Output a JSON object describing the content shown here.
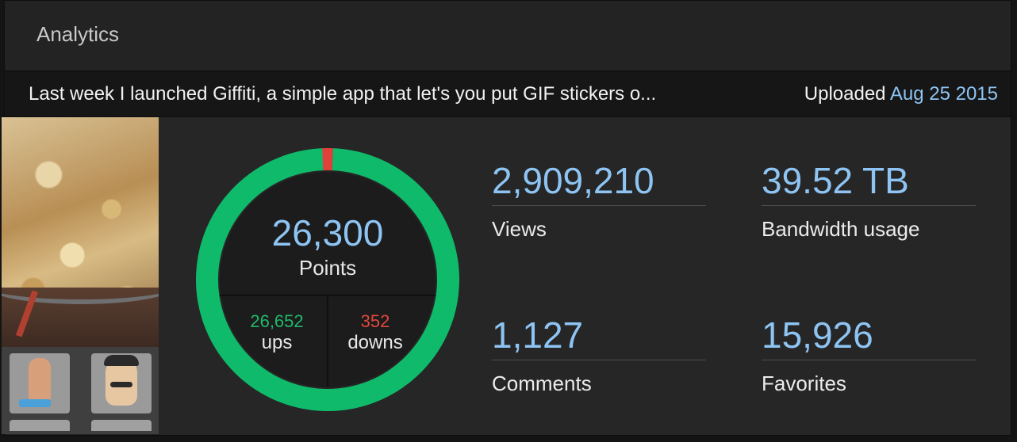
{
  "panel": {
    "title": "Analytics"
  },
  "post": {
    "title": "Last week I launched Giffiti, a simple app that let's you put GIF stickers o...",
    "uploaded_label": "Uploaded",
    "uploaded_date": "Aug 25 2015"
  },
  "score": {
    "points": "26,300",
    "points_label": "Points",
    "ups": "26,652",
    "ups_label": "ups",
    "downs": "352",
    "downs_label": "downs",
    "ups_count": 26652,
    "downs_count": 352
  },
  "stats": {
    "views": {
      "value": "2,909,210",
      "label": "Views"
    },
    "bandwidth": {
      "value": "39.52 TB",
      "label": "Bandwidth usage"
    },
    "comments": {
      "value": "1,127",
      "label": "Comments"
    },
    "favorites": {
      "value": "15,926",
      "label": "Favorites"
    }
  },
  "colors": {
    "accent": "#8ec4f3",
    "ups": "#21b86a",
    "downs": "#e0473c",
    "ring_up": "#0fba6a",
    "ring_down": "#e2403a"
  },
  "thumbnails": {
    "main": "paella-pan-image",
    "tiles": [
      "figure-sticker-tile",
      "mustache-face-tile"
    ]
  }
}
